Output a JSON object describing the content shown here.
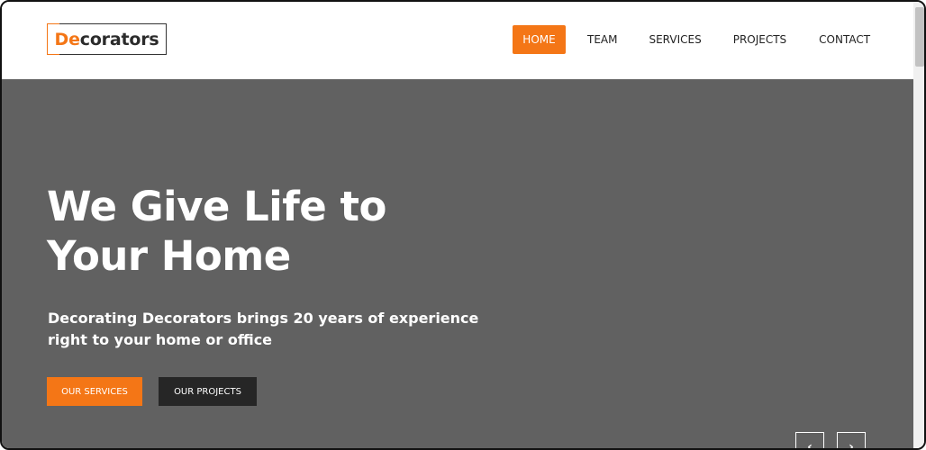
{
  "logo": {
    "accent_text": "De",
    "rest_text": "corators"
  },
  "nav": {
    "items": [
      {
        "label": "HOME",
        "active": true
      },
      {
        "label": "TEAM",
        "active": false
      },
      {
        "label": "SERVICES",
        "active": false
      },
      {
        "label": "PROJECTS",
        "active": false
      },
      {
        "label": "CONTACT",
        "active": false
      }
    ]
  },
  "hero": {
    "title_line1": "We Give Life to",
    "title_line2": "Your Home",
    "subtitle_line1": "Decorating Decorators brings 20 years of experience",
    "subtitle_line2": "right to your home or office",
    "primary_button": "OUR SERVICES",
    "secondary_button": "OUR PROJECTS"
  },
  "slider": {
    "prev_icon": "chevron-left-icon",
    "next_icon": "chevron-right-icon",
    "prev_glyph": "‹",
    "next_glyph": "›"
  },
  "colors": {
    "accent": "#f47616",
    "hero_background": "#616161",
    "dark_button": "#262626",
    "text_dark": "#222222"
  }
}
